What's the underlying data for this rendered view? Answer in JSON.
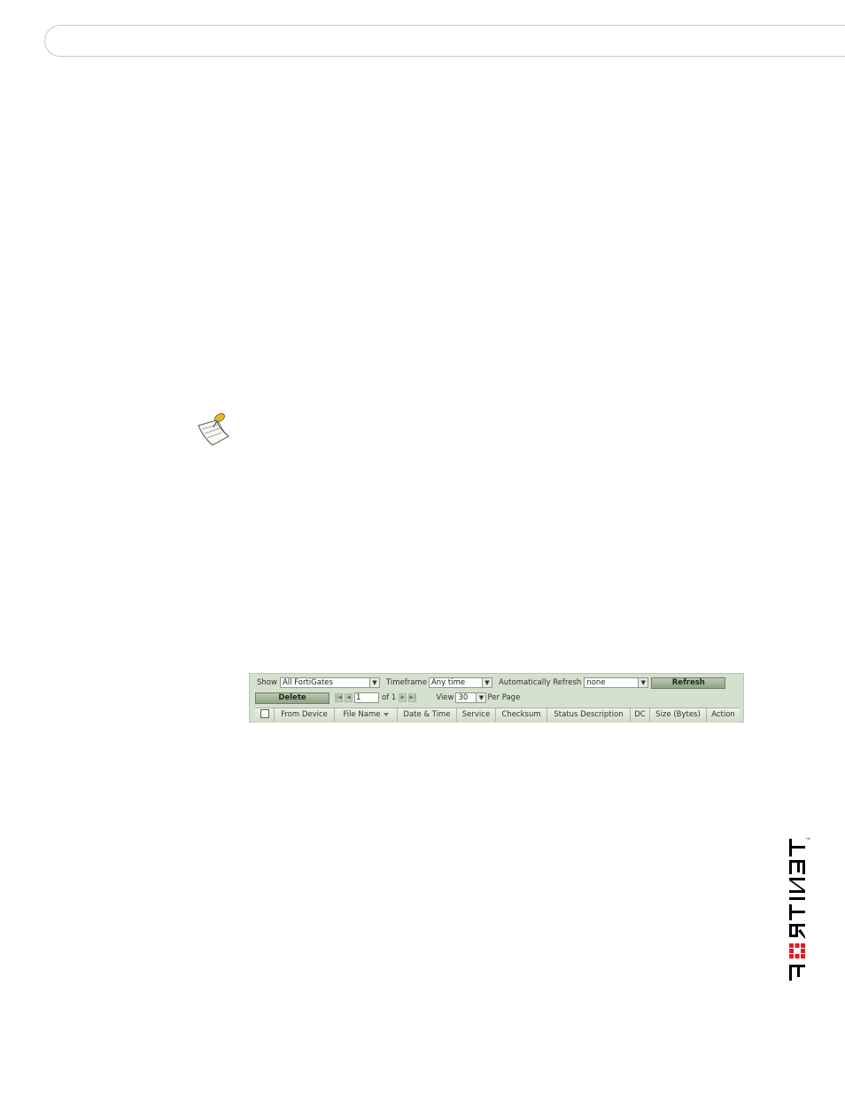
{
  "document": {
    "note_icon": "note-pin-icon"
  },
  "panel": {
    "show_label": "Show",
    "show_value": "All FortiGates",
    "timeframe_label": "Timeframe",
    "timeframe_value": "Any time",
    "auto_refresh_label": "Automatically Refresh",
    "auto_refresh_value": "none",
    "refresh_button": "Refresh",
    "delete_button": "Delete",
    "page_value": "1",
    "of_label": "of 1",
    "view_label": "View",
    "view_value": "30",
    "per_page_label": "Per Page",
    "columns": [
      "From Device",
      "File Name",
      "Date & Time",
      "Service",
      "Checksum",
      "Status Description",
      "DC",
      "Size (Bytes)",
      "Action"
    ],
    "sorted_column_icon": "sort-down-icon"
  },
  "logo": {
    "text": "FORTINET",
    "brand_color": "#000000",
    "accent_color": "#e21b23"
  }
}
